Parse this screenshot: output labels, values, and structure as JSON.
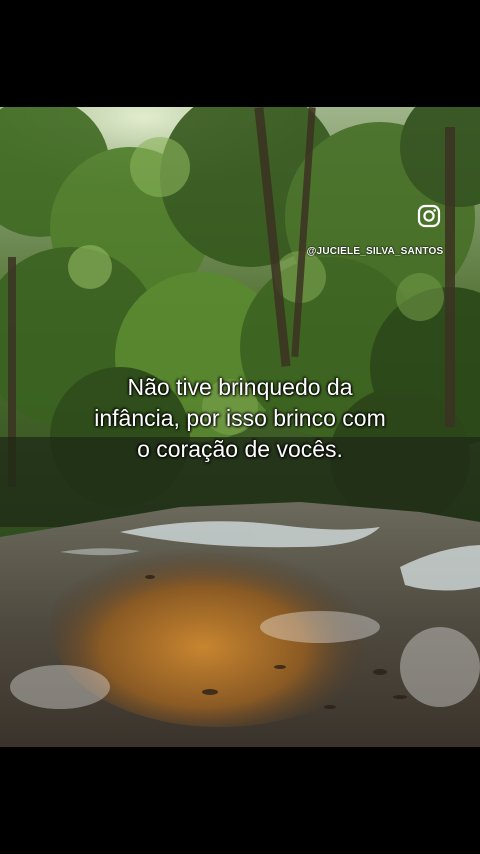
{
  "video": {
    "watermark": {
      "icon": "instagram-icon",
      "handle": "@JUCIELE_SILVA_SANTOS"
    },
    "caption": {
      "lines": [
        "Não tive brinquedo da",
        "infância, por isso brinco com",
        "o coração de vocês."
      ]
    },
    "colors": {
      "background": "#000000",
      "caption_text": "#ffffff"
    }
  }
}
